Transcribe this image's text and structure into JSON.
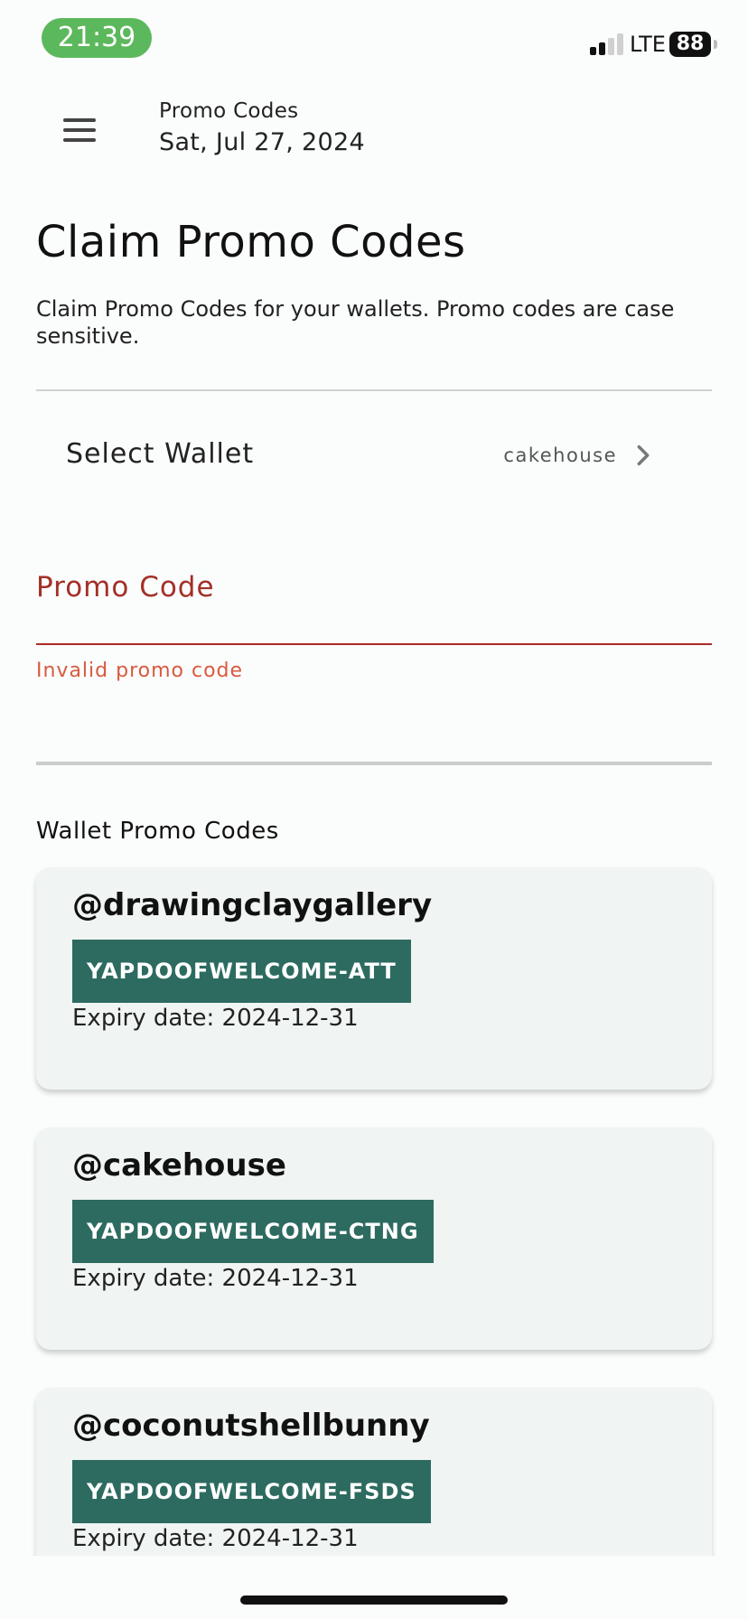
{
  "status_bar": {
    "time": "21:39",
    "network": "LTE",
    "battery": "88"
  },
  "header": {
    "title": "Promo Codes",
    "date": "Sat, Jul 27, 2024"
  },
  "main": {
    "title": "Claim Promo Codes",
    "description": "Claim Promo Codes for your wallets. Promo codes are case sensitive.",
    "select_wallet": {
      "label": "Select Wallet",
      "value": "cakehouse"
    },
    "promo_field": {
      "label": "Promo Code",
      "value": "",
      "error": "Invalid promo code"
    },
    "wallet_promo_codes": {
      "title": "Wallet Promo Codes",
      "cards": [
        {
          "handle": "@drawingclaygallery",
          "code": "YAPDOOFWELCOME-ATT",
          "expiry": "Expiry date: 2024-12-31"
        },
        {
          "handle": "@cakehouse",
          "code": "YAPDOOFWELCOME-CTNG",
          "expiry": "Expiry date: 2024-12-31"
        },
        {
          "handle": "@coconutshellbunny",
          "code": "YAPDOOFWELCOME-FSDS",
          "expiry": "Expiry date: 2024-12-31"
        }
      ]
    }
  },
  "icons": {
    "menu": "menu-icon",
    "chevron": "chevron-right-icon",
    "signal": "signal-icon",
    "battery": "battery-icon"
  },
  "colors": {
    "status_pill": "#5cb85c",
    "error_label": "#a33027",
    "error_text": "#d85a3f",
    "code_badge": "#2d6b60",
    "card_background": "#f0f4f3"
  }
}
